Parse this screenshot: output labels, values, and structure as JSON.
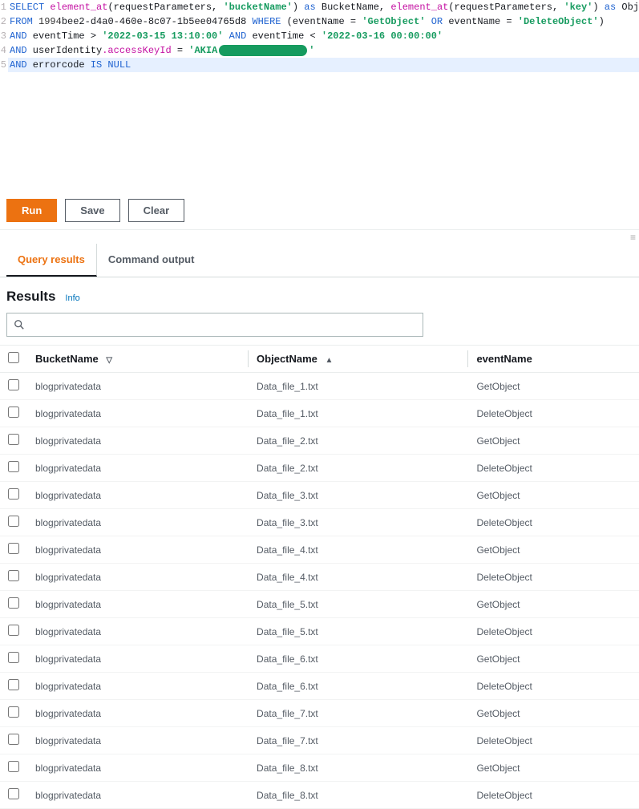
{
  "editor": {
    "lines": [
      [
        {
          "cls": "kwd",
          "t": "SELECT "
        },
        {
          "cls": "func",
          "t": "element_at"
        },
        {
          "cls": "",
          "t": "(requestParameters, "
        },
        {
          "cls": "str",
          "t": "'bucketName'"
        },
        {
          "cls": "",
          "t": ") "
        },
        {
          "cls": "kwd",
          "t": "as"
        },
        {
          "cls": "",
          "t": " BucketName, "
        },
        {
          "cls": "func",
          "t": "element_at"
        },
        {
          "cls": "",
          "t": "(requestParameters, "
        },
        {
          "cls": "str",
          "t": "'key'"
        },
        {
          "cls": "",
          "t": ") "
        },
        {
          "cls": "kwd",
          "t": "as"
        },
        {
          "cls": "",
          "t": " ObjectName, eventName"
        }
      ],
      [
        {
          "cls": "kwd",
          "t": "FROM "
        },
        {
          "cls": "num",
          "t": "1994"
        },
        {
          "cls": "",
          "t": "bee2-d4a0-460e-8c07-1b5ee04765d8 "
        },
        {
          "cls": "kwd",
          "t": "WHERE"
        },
        {
          "cls": "",
          "t": " (eventName = "
        },
        {
          "cls": "str",
          "t": "'GetObject'"
        },
        {
          "cls": "",
          "t": " "
        },
        {
          "cls": "kwd",
          "t": "OR"
        },
        {
          "cls": "",
          "t": " eventName = "
        },
        {
          "cls": "str",
          "t": "'DeleteObject'"
        },
        {
          "cls": "",
          "t": ")"
        }
      ],
      [
        {
          "cls": "kwd",
          "t": "AND"
        },
        {
          "cls": "",
          "t": " eventTime > "
        },
        {
          "cls": "str",
          "t": "'2022-03-15 13:10:00'"
        },
        {
          "cls": "",
          "t": " "
        },
        {
          "cls": "kwd",
          "t": "AND"
        },
        {
          "cls": "",
          "t": " eventTime < "
        },
        {
          "cls": "str",
          "t": "'2022-03-16 00:00:00'"
        }
      ],
      [
        {
          "cls": "kwd",
          "t": "AND"
        },
        {
          "cls": "",
          "t": " userIdentity"
        },
        {
          "cls": "dot",
          "t": ".accessKeyId"
        },
        {
          "cls": "",
          "t": " = "
        },
        {
          "cls": "str",
          "t": "'AKIA"
        },
        {
          "cls": "redact",
          "t": ""
        },
        {
          "cls": "str",
          "t": "'"
        }
      ],
      [
        {
          "cls": "kwd",
          "t": "AND"
        },
        {
          "cls": "",
          "t": " errorcode "
        },
        {
          "cls": "kwd",
          "t": "IS NULL"
        }
      ]
    ],
    "highlight_line_index": 4
  },
  "buttons": {
    "run": "Run",
    "save": "Save",
    "clear": "Clear"
  },
  "tabs": {
    "query_results": "Query results",
    "command_output": "Command output",
    "active": "query_results"
  },
  "results": {
    "heading": "Results",
    "info": "Info",
    "filter_placeholder": "",
    "columns": [
      {
        "key": "BucketName",
        "label": "BucketName",
        "sort": "desc-ind"
      },
      {
        "key": "ObjectName",
        "label": "ObjectName",
        "sort": "asc"
      },
      {
        "key": "eventName",
        "label": "eventName",
        "sort": ""
      }
    ],
    "rows": [
      {
        "BucketName": "blogprivatedata",
        "ObjectName": "Data_file_1.txt",
        "eventName": "GetObject"
      },
      {
        "BucketName": "blogprivatedata",
        "ObjectName": "Data_file_1.txt",
        "eventName": "DeleteObject"
      },
      {
        "BucketName": "blogprivatedata",
        "ObjectName": "Data_file_2.txt",
        "eventName": "GetObject"
      },
      {
        "BucketName": "blogprivatedata",
        "ObjectName": "Data_file_2.txt",
        "eventName": "DeleteObject"
      },
      {
        "BucketName": "blogprivatedata",
        "ObjectName": "Data_file_3.txt",
        "eventName": "GetObject"
      },
      {
        "BucketName": "blogprivatedata",
        "ObjectName": "Data_file_3.txt",
        "eventName": "DeleteObject"
      },
      {
        "BucketName": "blogprivatedata",
        "ObjectName": "Data_file_4.txt",
        "eventName": "GetObject"
      },
      {
        "BucketName": "blogprivatedata",
        "ObjectName": "Data_file_4.txt",
        "eventName": "DeleteObject"
      },
      {
        "BucketName": "blogprivatedata",
        "ObjectName": "Data_file_5.txt",
        "eventName": "GetObject"
      },
      {
        "BucketName": "blogprivatedata",
        "ObjectName": "Data_file_5.txt",
        "eventName": "DeleteObject"
      },
      {
        "BucketName": "blogprivatedata",
        "ObjectName": "Data_file_6.txt",
        "eventName": "GetObject"
      },
      {
        "BucketName": "blogprivatedata",
        "ObjectName": "Data_file_6.txt",
        "eventName": "DeleteObject"
      },
      {
        "BucketName": "blogprivatedata",
        "ObjectName": "Data_file_7.txt",
        "eventName": "GetObject"
      },
      {
        "BucketName": "blogprivatedata",
        "ObjectName": "Data_file_7.txt",
        "eventName": "DeleteObject"
      },
      {
        "BucketName": "blogprivatedata",
        "ObjectName": "Data_file_8.txt",
        "eventName": "GetObject"
      },
      {
        "BucketName": "blogprivatedata",
        "ObjectName": "Data_file_8.txt",
        "eventName": "DeleteObject"
      }
    ]
  }
}
